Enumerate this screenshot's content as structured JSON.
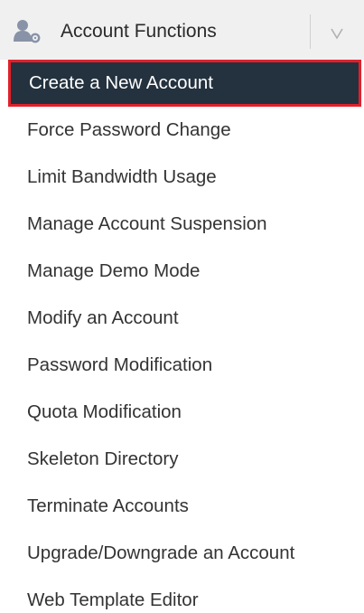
{
  "header": {
    "title": "Account Functions",
    "icon": "user-gear-icon",
    "toggle_icon": "chevron-down-icon"
  },
  "menu": {
    "active_index": 0,
    "items": [
      {
        "label": "Create a New Account"
      },
      {
        "label": "Force Password Change"
      },
      {
        "label": "Limit Bandwidth Usage"
      },
      {
        "label": "Manage Account Suspension"
      },
      {
        "label": "Manage Demo Mode"
      },
      {
        "label": "Modify an Account"
      },
      {
        "label": "Password Modification"
      },
      {
        "label": "Quota Modification"
      },
      {
        "label": "Skeleton Directory"
      },
      {
        "label": "Terminate Accounts"
      },
      {
        "label": "Upgrade/Downgrade an Account"
      },
      {
        "label": "Web Template Editor"
      }
    ]
  },
  "colors": {
    "header_bg": "#f0f0f0",
    "active_bg": "#24323f",
    "active_border": "#e1202a",
    "text": "#333333",
    "icon": "#8893a8"
  }
}
